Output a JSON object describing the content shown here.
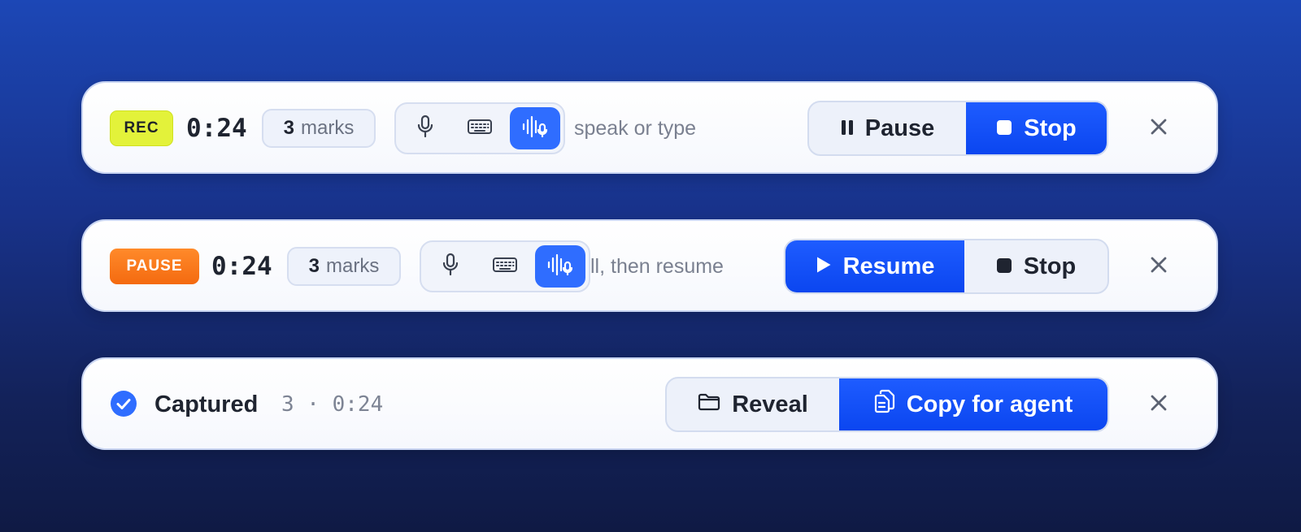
{
  "recording_bar": {
    "badge": "REC",
    "badge_color": "#e3f23a",
    "timer": "0:24",
    "marks_count": "3",
    "marks_label": "marks",
    "modes": [
      {
        "icon": "microphone-icon",
        "active": false
      },
      {
        "icon": "keyboard-icon",
        "active": false
      },
      {
        "icon": "voice-waveform-icon",
        "active": true
      }
    ],
    "hint": "speak or type",
    "pause_label": "Pause",
    "stop_label": "Stop",
    "close_icon": "close-icon"
  },
  "paused_bar": {
    "badge": "PAUSE",
    "badge_color": "#f46a10",
    "timer": "0:24",
    "marks_count": "3",
    "marks_label": "marks",
    "modes": [
      {
        "icon": "microphone-icon",
        "active": false
      },
      {
        "icon": "keyboard-icon",
        "active": false
      },
      {
        "icon": "voice-waveform-icon",
        "active": true
      }
    ],
    "hint": "ll, then resume",
    "resume_label": "Resume",
    "stop_label": "Stop",
    "close_icon": "close-icon"
  },
  "captured_bar": {
    "status_icon": "check-circle-icon",
    "status_label": "Captured",
    "meta": "3 · 0:24",
    "reveal_label": "Reveal",
    "copy_label": "Copy for agent",
    "close_icon": "close-icon"
  },
  "colors": {
    "accent": "#1e5cff",
    "active_mode": "#2f6dff"
  }
}
